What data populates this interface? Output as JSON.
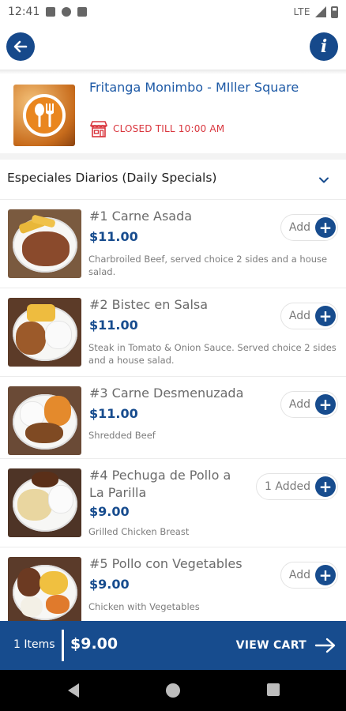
{
  "status_bar": {
    "time": "12:41",
    "network": "LTE"
  },
  "header": {
    "back_icon": "arrow-left-icon",
    "info_icon": "info-icon",
    "info_glyph": "i"
  },
  "restaurant": {
    "name": "Fritanga Monimbo - MIller Square",
    "status": "CLOSED TILL 10:00 AM",
    "status_color": "#d9363e"
  },
  "category": {
    "label": "Especiales Diarios (Daily Specials)"
  },
  "menu_items": [
    {
      "name": "#1 Carne Asada",
      "price": "$11.00",
      "description": "Charbroiled Beef, served choice 2 sides and a house salad.",
      "button": "Add"
    },
    {
      "name": "#2 Bistec en Salsa",
      "price": "$11.00",
      "description": "Steak in Tomato & Onion Sauce. Served choice 2 sides and a house salad.",
      "button": "Add"
    },
    {
      "name": "#3 Carne Desmenuzada",
      "price": "$11.00",
      "description": "Shredded Beef",
      "button": "Add"
    },
    {
      "name": "#4 Pechuga de Pollo a La Parilla",
      "price": "$9.00",
      "description": "Grilled Chicken Breast",
      "button": "1 Added"
    },
    {
      "name": "#5 Pollo con Vegetables",
      "price": "$9.00",
      "description": "Chicken with Vegetables",
      "button": "Add"
    }
  ],
  "cart": {
    "count": "1 Items",
    "total": "$9.00",
    "action": "VIEW CART"
  },
  "colors": {
    "brand": "#174c8e",
    "link": "#1e5aa6"
  }
}
